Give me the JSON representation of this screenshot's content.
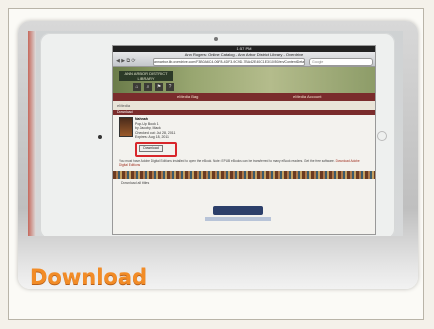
{
  "slide": {
    "caption": "Download"
  },
  "tablet": {
    "status_bar": "1:57 PM",
    "browser": {
      "title": "Ann Rogers: Online Catalog - Ann Arbor District Library - Overdrive",
      "nav": "◀ ▶ ⧉ ⟳",
      "url": "annarbor.lib.overdrive.com/F3B0A6C4-06F8-4DF3-9C9D-7BA42E40C1E3/10/50/en/ContentDetails",
      "search_placeholder": "Google"
    },
    "site": {
      "logo": "ANN ARBOR DISTRICT LIBRARY",
      "tools": [
        "⌂",
        "⌕",
        "⚑",
        "?"
      ],
      "nav_left": "eMedia Bag",
      "nav_right": "eMedia Account",
      "crumb": "eMedia",
      "section": "Download",
      "book_title": "Nahnah",
      "book_subtitle": "Pop-Up Book 1",
      "book_author": "by Jacoby, Mack",
      "book_meta1": "Checked out: Jul 28, 2011",
      "book_meta2": "Expires: Aug 18, 2011",
      "download_label": "Download",
      "desc_line1": "You must have Adobe Digital Editions installed to open the eBook. Note: EPUB eBooks can be transferred to many eBook readers. Get the free software.",
      "desc_link": "Download Adobe Digital Editions",
      "sub_link": "Download all titles"
    }
  }
}
